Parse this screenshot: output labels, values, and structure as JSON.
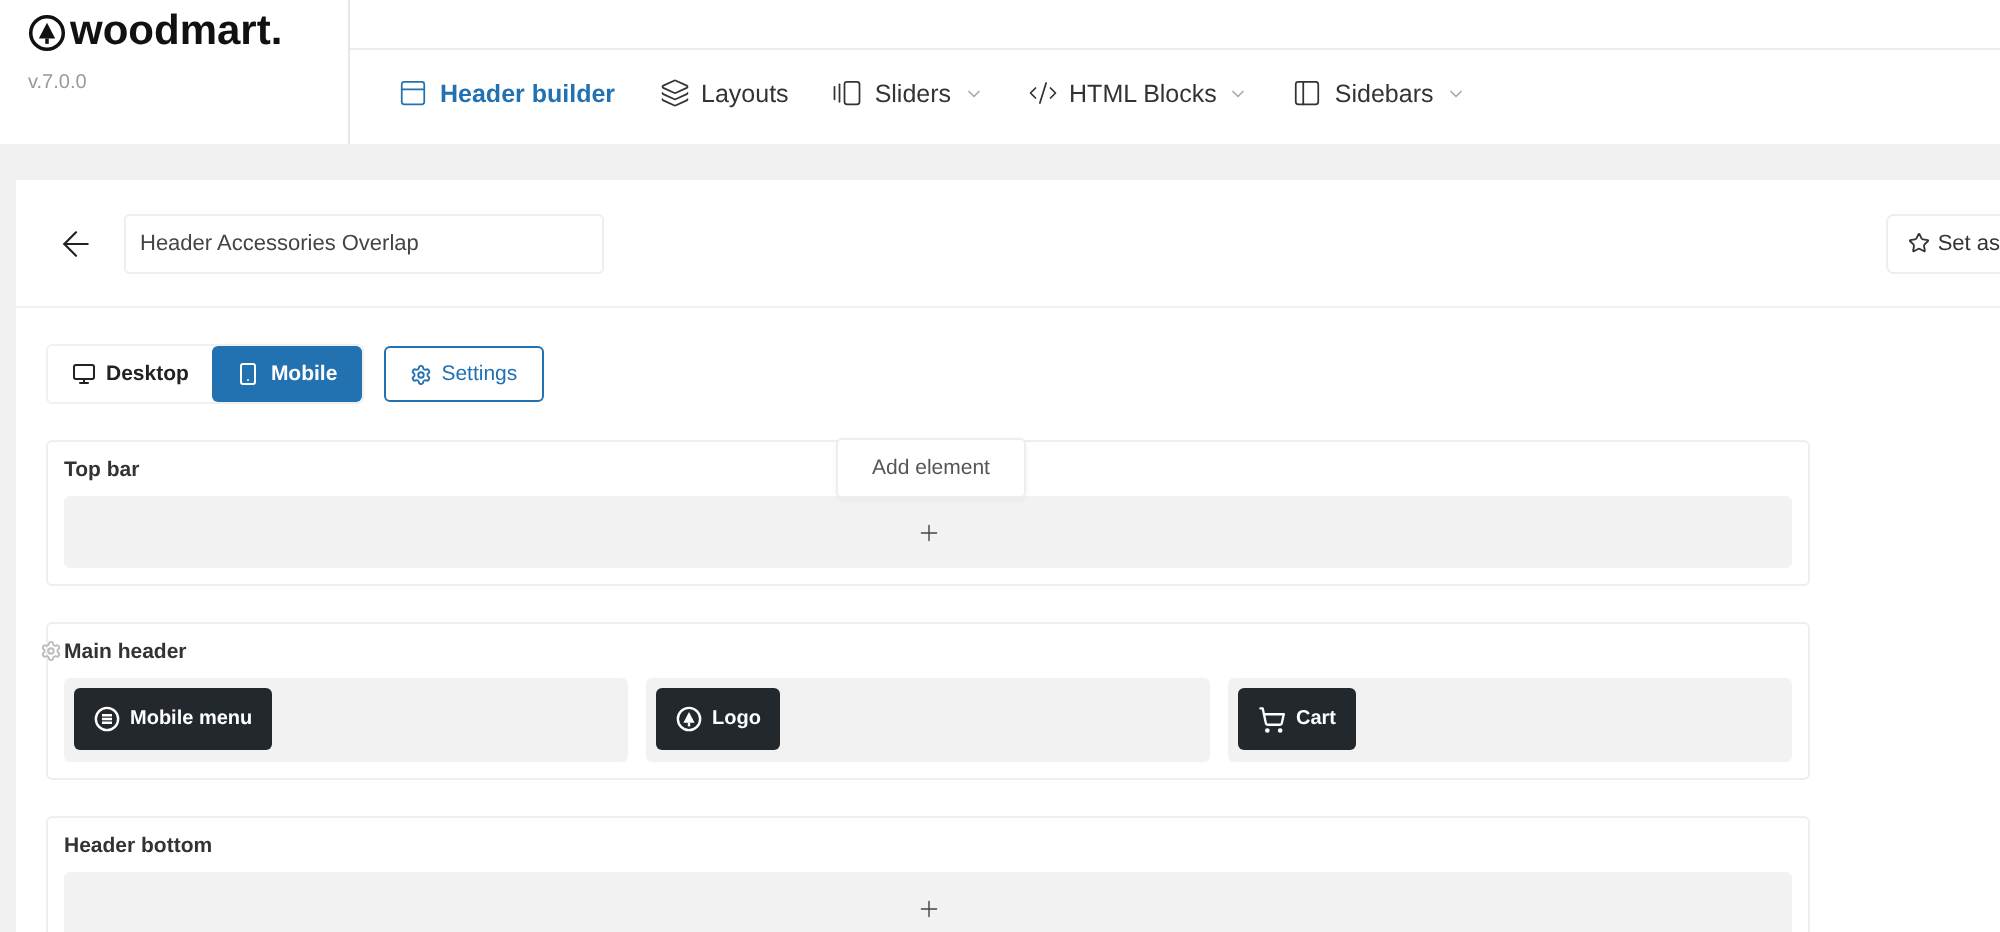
{
  "brand": {
    "name": "woodmart.",
    "version": "v.7.0.0"
  },
  "nav": [
    {
      "label": "Header builder",
      "selected": true,
      "dropdown": false
    },
    {
      "label": "Layouts",
      "selected": false,
      "dropdown": false
    },
    {
      "label": "Sliders",
      "selected": false,
      "dropdown": true
    },
    {
      "label": "HTML Blocks",
      "selected": false,
      "dropdown": true
    },
    {
      "label": "Sidebars",
      "selected": false,
      "dropdown": true
    }
  ],
  "title_field": {
    "value": "Header Accessories Overlap"
  },
  "set_as_button": {
    "label": "Set as"
  },
  "device_tabs": [
    {
      "label": "Desktop",
      "selected": false
    },
    {
      "label": "Mobile",
      "selected": true
    }
  ],
  "settings_button": {
    "label": "Settings"
  },
  "tooltip": {
    "label": "Add element"
  },
  "rows": [
    {
      "title": "Top bar",
      "columns": []
    },
    {
      "title": "Main header",
      "columns": [
        {
          "element": "Mobile menu"
        },
        {
          "element": "Logo"
        },
        {
          "element": "Cart"
        }
      ]
    },
    {
      "title": "Header bottom",
      "columns": []
    }
  ]
}
